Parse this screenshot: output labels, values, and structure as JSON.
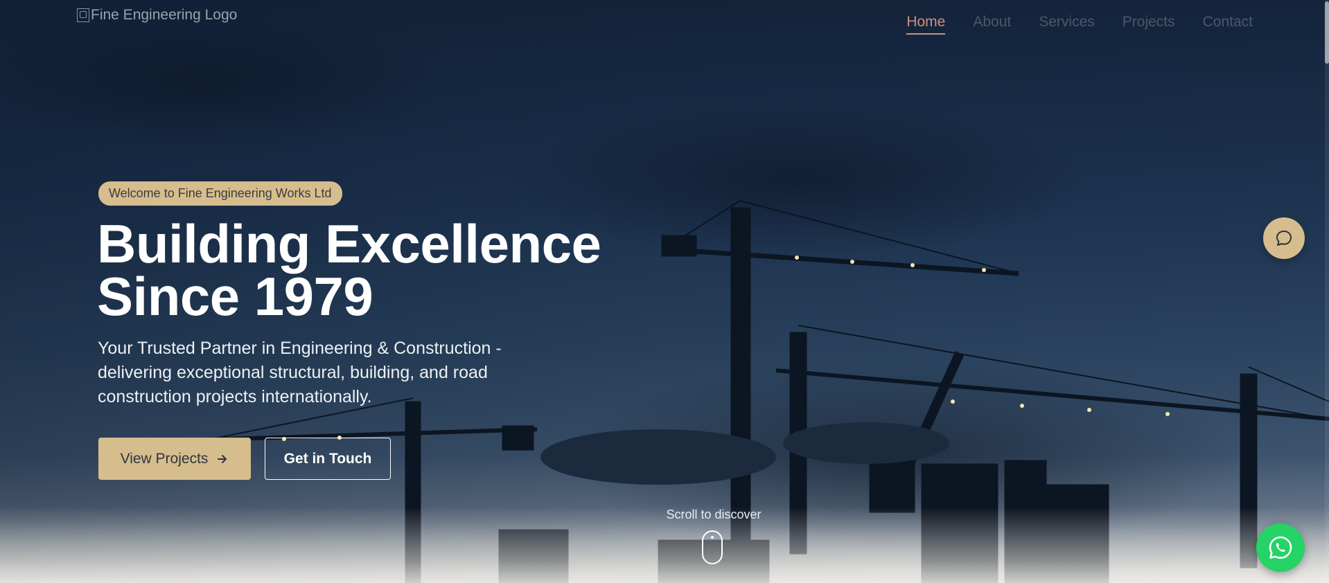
{
  "header": {
    "logo_alt": "Fine Engineering Logo",
    "nav": {
      "home": "Home",
      "about": "About",
      "services": "Services",
      "projects": "Projects",
      "contact": "Contact"
    },
    "active_nav": "Home"
  },
  "hero": {
    "badge": "Welcome to Fine Engineering Works Ltd",
    "headline_line1": "Building Excellence",
    "headline_line2": "Since 1979",
    "subtitle": "Your Trusted Partner in Engineering & Construction - delivering exceptional structural, building, and road construction projects internationally.",
    "primary_button": "View Projects",
    "secondary_button": "Get in Touch",
    "scroll_hint": "Scroll to discover"
  },
  "icons": {
    "arrow": "arrow-right-icon",
    "chat": "chat-bubble-icon",
    "whatsapp": "whatsapp-icon",
    "mouse": "mouse-scroll-icon",
    "logo": "broken-image-icon"
  },
  "colors": {
    "accent": "#d6bd8d",
    "nav_active": "#d38f7f",
    "nav_inactive": "#4b5869",
    "whatsapp": "#25d366",
    "sky_dark": "#13243b"
  }
}
